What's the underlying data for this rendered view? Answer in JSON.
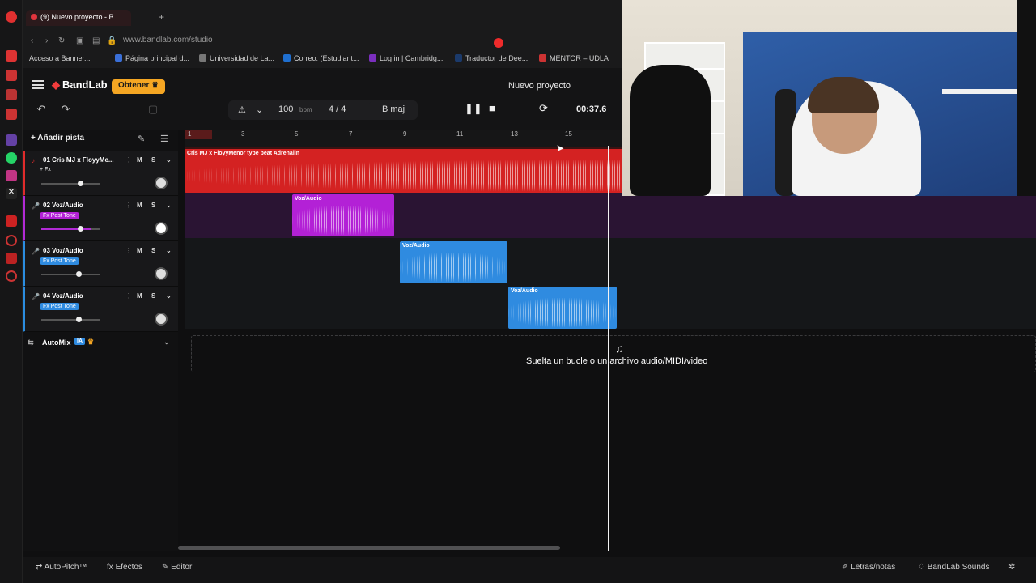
{
  "browser": {
    "tab_title": "(9) Nuevo proyecto - B",
    "new_tab": "+",
    "url": "www.bandlab.com/studio",
    "bookmarks": [
      "Acceso a Banner...",
      "Página principal d...",
      "Universidad de La...",
      "Correo: (Estudiant...",
      "Log in | Cambridg...",
      "Traductor de Dee...",
      "MENTOR – UDLA"
    ]
  },
  "header": {
    "logo": "BandLab",
    "obtener_label": "Obtener",
    "project_title": "Nuevo proyecto",
    "tempo_value": "100",
    "tempo_unit": "bpm",
    "time_sig": "4 / 4",
    "key": "B maj",
    "time": "00:37.6"
  },
  "trackpanel": {
    "add_track": "Añadir pista",
    "automix": "AutoMix",
    "automix_badge": "IA",
    "tracks": [
      {
        "name": "01  Cris MJ x FloyyMe...",
        "fx": "+ Fx",
        "m": "M",
        "s": "S",
        "slider": 0.62,
        "color": "#e02b2b"
      },
      {
        "name": "02  Voz/Audio",
        "fx": "Fx Post Tone",
        "m": "M",
        "s": "S",
        "slider": 0.62,
        "color": "#b22ad6"
      },
      {
        "name": "03  Voz/Audio",
        "fx": "Fx Post Tone",
        "m": "M",
        "s": "S",
        "slider": 0.6,
        "color": "#2b8de0"
      },
      {
        "name": "04  Voz/Audio",
        "fx": "Fx Post Tone",
        "m": "M",
        "s": "S",
        "slider": 0.6,
        "color": "#2b8de0"
      }
    ]
  },
  "ruler": {
    "ticks": [
      "1",
      "3",
      "5",
      "7",
      "9",
      "11",
      "13",
      "15"
    ]
  },
  "clips": [
    {
      "title": "Cris MJ x FloyyMenor type beat Adrenalin",
      "color": "#d42222"
    },
    {
      "title": "Voz/Audio",
      "color": "#b321d6"
    },
    {
      "title": "Voz/Audio",
      "color": "#2f8be0"
    },
    {
      "title": "Voz/Audio",
      "color": "#2f8be0"
    }
  ],
  "drop_text": "Suelta un bucle o un archivo audio/MIDI/video",
  "bottombar": {
    "autopitch": "AutoPitch™",
    "efectos": "Efectos",
    "editor": "Editor",
    "letras": "Letras/notas",
    "sounds": "BandLab Sounds"
  }
}
